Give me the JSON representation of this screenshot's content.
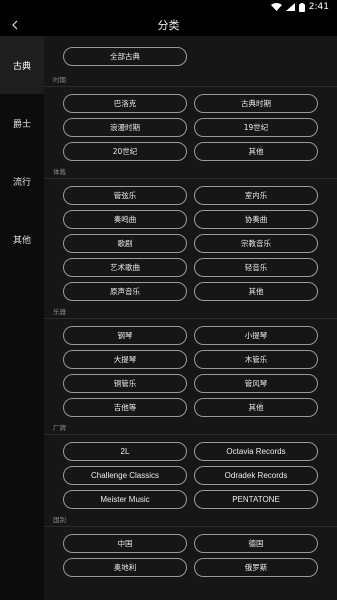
{
  "status": {
    "time": "2:41"
  },
  "header": {
    "title": "分类"
  },
  "sidebar": {
    "items": [
      {
        "label": "古典"
      },
      {
        "label": "爵士"
      },
      {
        "label": "流行"
      },
      {
        "label": "其他"
      }
    ]
  },
  "all_button": {
    "label": "全部古典"
  },
  "groups": {
    "period": {
      "title": "时期",
      "items": [
        "巴洛克",
        "古典时期",
        "浪漫时期",
        "19世纪",
        "20世纪",
        "其他"
      ]
    },
    "genre": {
      "title": "体裁",
      "items": [
        "管弦乐",
        "室内乐",
        "奏鸣曲",
        "协奏曲",
        "歌剧",
        "宗教音乐",
        "艺术歌曲",
        "轻音乐",
        "原声音乐",
        "其他"
      ]
    },
    "instrument": {
      "title": "乐器",
      "items": [
        "钢琴",
        "小提琴",
        "大提琴",
        "木管乐",
        "铜管乐",
        "管风琴",
        "吉他等",
        "其他"
      ]
    },
    "label": {
      "title": "厂牌",
      "items": [
        "2L",
        "Octavia Records",
        "Challenge Classics",
        "Odradek Records",
        "Meister Music",
        "PENTATONE"
      ]
    },
    "country": {
      "title": "国别",
      "items": [
        "中国",
        "德国",
        "奥地利",
        "俄罗斯"
      ]
    }
  }
}
